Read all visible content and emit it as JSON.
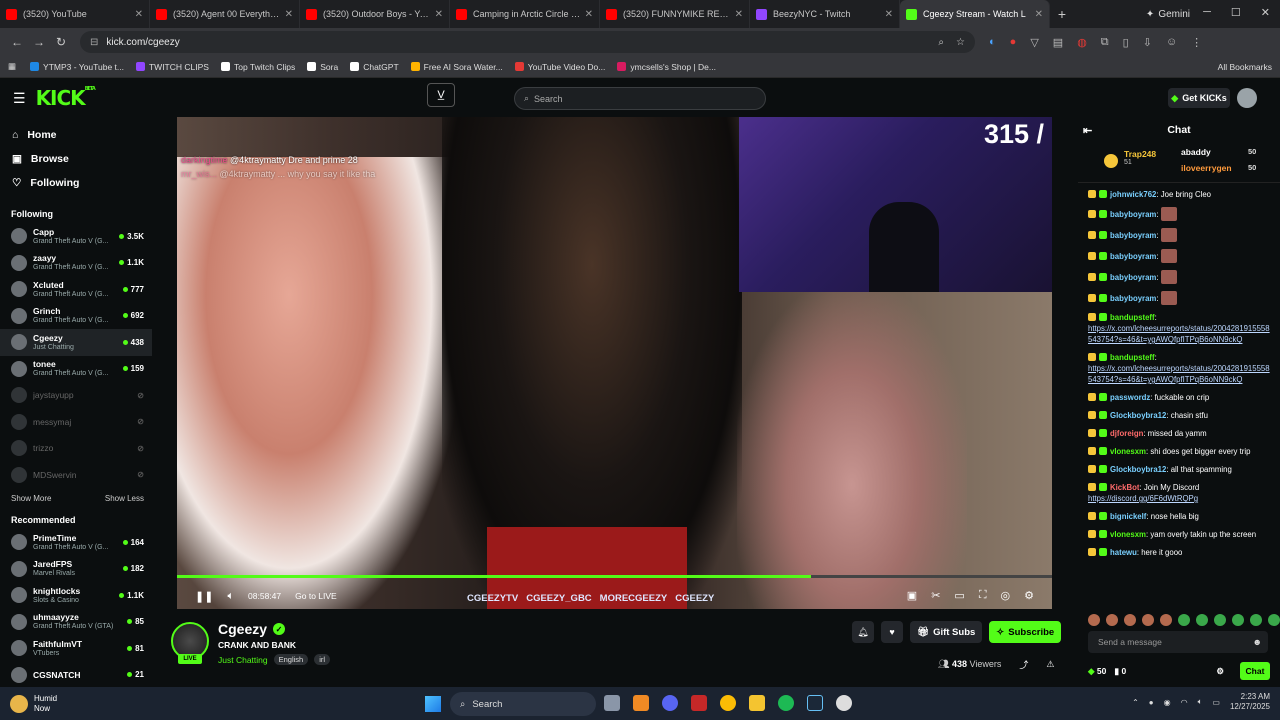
{
  "browser": {
    "tabs": [
      {
        "title": "(3520) YouTube",
        "color": "#ff0000"
      },
      {
        "title": "(3520) Agent 00 Everything -",
        "color": "#ff0000"
      },
      {
        "title": "(3520) Outdoor Boys - YouTu",
        "color": "#ff0000"
      },
      {
        "title": "Camping in Arctic Circle with",
        "color": "#ff0000"
      },
      {
        "title": "(3520) FUNNYMIKE RETURNS",
        "color": "#ff0000"
      },
      {
        "title": "BeezyNYC - Twitch",
        "color": "#9146ff"
      },
      {
        "title": "Cgeezy Stream - Watch L",
        "color": "#53fc18"
      }
    ],
    "gemini_label": "Gemini",
    "url": "kick.com/cgeezy",
    "bookmarks": [
      {
        "label": "YTMP3 - YouTube t...",
        "color": "#1e88e5"
      },
      {
        "label": "TWITCH CLIPS",
        "color": "#9146ff"
      },
      {
        "label": "Top Twitch Clips",
        "color": "#ffffff"
      },
      {
        "label": "Sora",
        "color": "#ffffff"
      },
      {
        "label": "ChatGPT",
        "color": "#ffffff"
      },
      {
        "label": "Free AI Sora Water...",
        "color": "#ffb300"
      },
      {
        "label": "YouTube Video Do...",
        "color": "#e53935"
      },
      {
        "label": "ymcsells's Shop | De...",
        "color": "#d81b60"
      }
    ],
    "all_bookmarks": "All Bookmarks"
  },
  "kick": {
    "logo": "KICK",
    "logo_sup": "BETA",
    "search_placeholder": "Search",
    "get_kicks": "Get KICKs",
    "nav": [
      {
        "label": "Home",
        "icon": "⌂"
      },
      {
        "label": "Browse",
        "icon": "▣"
      },
      {
        "label": "Following",
        "icon": "♡"
      }
    ],
    "following_title": "Following",
    "following": [
      {
        "name": "Capp",
        "cat": "Grand Theft Auto V (G...",
        "viewers": "3.5K",
        "live": true
      },
      {
        "name": "zaayy",
        "cat": "Grand Theft Auto V (G...",
        "viewers": "1.1K",
        "live": true
      },
      {
        "name": "Xcluted",
        "cat": "Grand Theft Auto V (G...",
        "viewers": "777",
        "live": true
      },
      {
        "name": "Grinch",
        "cat": "Grand Theft Auto V (G...",
        "viewers": "692",
        "live": true
      },
      {
        "name": "Cgeezy",
        "cat": "Just Chatting",
        "viewers": "438",
        "live": true
      },
      {
        "name": "tonee",
        "cat": "Grand Theft Auto V (G...",
        "viewers": "159",
        "live": true
      },
      {
        "name": "jaystayupp",
        "cat": "",
        "viewers": "",
        "live": false
      },
      {
        "name": "messymaj",
        "cat": "",
        "viewers": "",
        "live": false
      },
      {
        "name": "trizzo",
        "cat": "",
        "viewers": "",
        "live": false
      },
      {
        "name": "MDSwervin",
        "cat": "",
        "viewers": "",
        "live": false
      }
    ],
    "show_more": "Show More",
    "show_less": "Show Less",
    "recommended_title": "Recommended",
    "recommended": [
      {
        "name": "PrimeTime",
        "cat": "Grand Theft Auto V (G...",
        "viewers": "164"
      },
      {
        "name": "JaredFPS",
        "cat": "Marvel Rivals",
        "viewers": "182"
      },
      {
        "name": "knightlocks",
        "cat": "Slots & Casino",
        "viewers": "1.1K"
      },
      {
        "name": "uhmaayyze",
        "cat": "Grand Theft Auto V (GTA)",
        "viewers": "85"
      },
      {
        "name": "FaithfulmVT",
        "cat": "VTubers",
        "viewers": "81"
      },
      {
        "name": "CGSNATCH",
        "cat": "",
        "viewers": "21"
      }
    ]
  },
  "player": {
    "overlay_count": "315 /",
    "overlay_chat_user": "darkingtime",
    "overlay_chat_text": "@4ktraymatty Dre and prime 28",
    "overlay_chat_user2": "mr_wis...",
    "overlay_chat_text2": "@4ktraymatty ... why you say it like tha",
    "time": "08:58:47",
    "go_live": "Go to LIVE",
    "progress": 0.725,
    "socials": [
      "CGEEZYTV",
      "CGEEZY_GBC",
      "MORECGEEZY",
      "CGEEZY"
    ]
  },
  "channel": {
    "name": "Cgeezy",
    "live_badge": "LIVE",
    "title": "CRANK AND BANK",
    "category": "Just Chatting",
    "tags": [
      "English",
      "irl"
    ],
    "gift_subs": "Gift Subs",
    "subscribe": "Subscribe",
    "viewers": "438",
    "viewers_label": "Viewers"
  },
  "chat": {
    "title": "Chat",
    "pinned": {
      "top_name": "Trap248",
      "top_value": "51",
      "second_name": "abaddy",
      "second_value": "50",
      "third_name": "iloveerrygen",
      "third_value": "50"
    },
    "messages": [
      {
        "user": "johnwick762",
        "color": "#7ad0ff",
        "text": "Joe bring Cleo"
      },
      {
        "user": "babyboyram",
        "color": "#7ad0ff",
        "text": ""
      },
      {
        "user": "babyboyram",
        "color": "#7ad0ff",
        "text": ""
      },
      {
        "user": "babyboyram",
        "color": "#7ad0ff",
        "text": ""
      },
      {
        "user": "babyboyram",
        "color": "#7ad0ff",
        "text": ""
      },
      {
        "user": "babyboyram",
        "color": "#7ad0ff",
        "text": ""
      },
      {
        "user": "bandupsteff",
        "color": "#53fc18",
        "text": "",
        "link": "https://x.com/lcheesurreports/status/2004281915558543754?s=46&t=ygAWQfpfITPqB6oNN9ckQ"
      },
      {
        "user": "bandupsteff",
        "color": "#53fc18",
        "text": "",
        "link": "https://x.com/lcheesurreports/status/2004281915558543754?s=46&t=ygAWQfpfITPqB6oNN9ckQ"
      },
      {
        "user": "passwordz",
        "color": "#7ad0ff",
        "text": "fuckable on crip"
      },
      {
        "user": "Glockboybra12",
        "color": "#7ad0ff",
        "text": "chasin stfu"
      },
      {
        "user": "djforeign",
        "color": "#ff6b6b",
        "text": "missed da yamm"
      },
      {
        "user": "vlonesxm",
        "color": "#53fc18",
        "text": "shi does get bigger every trip"
      },
      {
        "user": "Glockboybra12",
        "color": "#7ad0ff",
        "text": "all that spamming"
      },
      {
        "user": "KickBot",
        "color": "#ff6b6b",
        "text": "Join My Discord",
        "link": "https://discord.gg/6F6dWtRQPg"
      },
      {
        "user": "bignickelf",
        "color": "#7ad0ff",
        "text": "nose hella big"
      },
      {
        "user": "vlonesxm",
        "color": "#53fc18",
        "text": "yam overly takin up the screen"
      },
      {
        "user": "hatewu",
        "color": "#7ad0ff",
        "text": "here it gooo"
      }
    ],
    "send_placeholder": "Send a message",
    "points": "50",
    "kicks": "0",
    "chat_button": "Chat"
  },
  "taskbar": {
    "weather_title": "Humid",
    "weather_sub": "Now",
    "search": "Search",
    "time": "2:23 AM",
    "date": "12/27/2025"
  }
}
